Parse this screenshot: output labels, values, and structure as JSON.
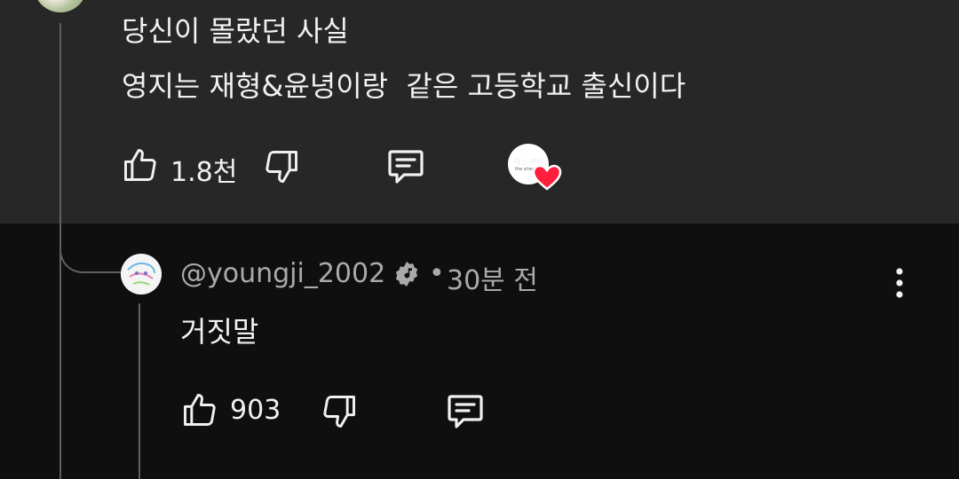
{
  "parent_comment": {
    "lines": [
      "당신이 몰랐던 사실",
      "영지는 재형&윤녕이랑  같은 고등학교 출신이다"
    ],
    "like_count": "1.8천",
    "icons": {
      "like": "thumbs-up-icon",
      "dislike": "thumbs-down-icon",
      "reply": "comment-reply-icon",
      "creator_heart": "heart-icon"
    },
    "creator_badge_text": "하스 팬터",
    "creator_badge_small": "the stream"
  },
  "reply": {
    "handle": "@youngji_2002",
    "separator": "•",
    "time": "30분 전",
    "text": "거짓말",
    "like_count": "903",
    "icons": {
      "verified": "verified-badge-icon",
      "menu": "more-vert-icon",
      "like": "thumbs-up-icon",
      "dislike": "thumbs-down-icon",
      "reply": "comment-reply-icon"
    }
  },
  "colors": {
    "top_bg": "#272727",
    "page_bg": "#0f0f0f",
    "text": "#f1f1f1",
    "muted": "#aaaaaa",
    "heart": "#ff1f3d"
  }
}
